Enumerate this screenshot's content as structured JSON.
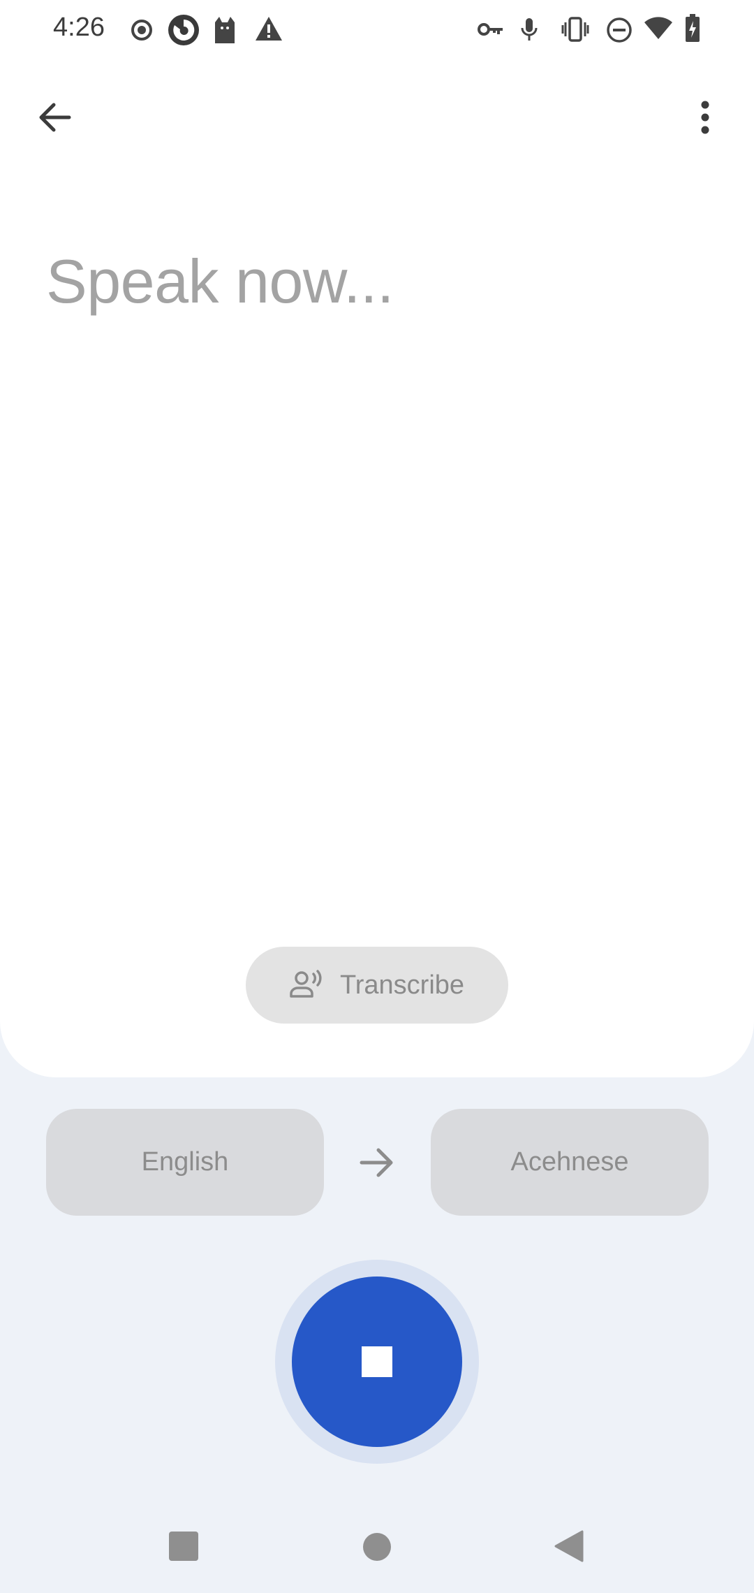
{
  "status_bar": {
    "time": "4:26",
    "left_icons": [
      "record-icon",
      "app-icon",
      "cat-icon",
      "warning-icon"
    ],
    "right_icons": [
      "vpn-key-icon",
      "microphone-icon",
      "vibrate-icon",
      "do-not-disturb-icon",
      "wifi-icon",
      "battery-charging-icon"
    ]
  },
  "app_bar": {
    "back_icon": "arrow-back-icon",
    "menu_icon": "more-vert-icon"
  },
  "main": {
    "prompt": "Speak now..."
  },
  "transcribe": {
    "icon": "voice-person-icon",
    "label": "Transcribe"
  },
  "languages": {
    "source": "English",
    "target": "Acehnese",
    "swap_icon": "arrow-right-icon"
  },
  "mic": {
    "state_icon": "stop-icon",
    "accent": "#2658c8",
    "halo": "#d9e2f2"
  },
  "nav_bar": {
    "items": [
      "recents-square-icon",
      "home-circle-icon",
      "back-triangle-icon"
    ]
  }
}
